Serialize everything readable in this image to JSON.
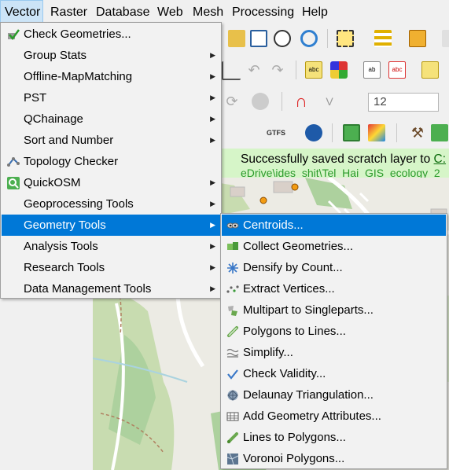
{
  "menubar": {
    "items": [
      {
        "label": "Vector",
        "active": true
      },
      {
        "label": "Raster"
      },
      {
        "label": "Database"
      },
      {
        "label": "Web"
      },
      {
        "label": "Mesh"
      },
      {
        "label": "Processing"
      },
      {
        "label": "Help"
      }
    ]
  },
  "toolbar": {
    "zoom_value": "12"
  },
  "message_bar": {
    "text": "Successfully saved scratch layer to ",
    "link": "C:",
    "path_fragment": "eDrive\\ides_shit\\Tel_Hai_GIS_ecology_2"
  },
  "vector_menu": {
    "items": [
      {
        "label": "Check Geometries...",
        "icon": "check-geometries-icon",
        "submenu": false
      },
      {
        "label": "Group Stats",
        "submenu": true
      },
      {
        "label": "Offline-MapMatching",
        "submenu": true
      },
      {
        "label": "PST",
        "submenu": true
      },
      {
        "label": "QChainage",
        "submenu": true
      },
      {
        "label": "Sort and Number",
        "submenu": true
      },
      {
        "label": "Topology Checker",
        "icon": "topology-checker-icon",
        "submenu": false
      },
      {
        "label": "QuickOSM",
        "icon": "quickosm-icon",
        "submenu": true
      },
      {
        "label": "Geoprocessing Tools",
        "submenu": true
      },
      {
        "label": "Geometry Tools",
        "submenu": true,
        "highlighted": true
      },
      {
        "label": "Analysis Tools",
        "submenu": true
      },
      {
        "label": "Research Tools",
        "submenu": true
      },
      {
        "label": "Data Management Tools",
        "submenu": true
      }
    ]
  },
  "geometry_tools_menu": {
    "items": [
      {
        "label": "Centroids...",
        "icon": "centroids-icon",
        "highlighted": true
      },
      {
        "label": "Collect Geometries...",
        "icon": "collect-geometries-icon"
      },
      {
        "label": "Densify by Count...",
        "icon": "densify-icon"
      },
      {
        "label": "Extract Vertices...",
        "icon": "extract-vertices-icon"
      },
      {
        "label": "Multipart to Singleparts...",
        "icon": "multipart-icon"
      },
      {
        "label": "Polygons to Lines...",
        "icon": "polygons-to-lines-icon"
      },
      {
        "label": "Simplify...",
        "icon": "simplify-icon"
      },
      {
        "label": "Check Validity...",
        "icon": "check-validity-icon"
      },
      {
        "label": "Delaunay Triangulation...",
        "icon": "delaunay-icon"
      },
      {
        "label": "Add Geometry Attributes...",
        "icon": "add-geometry-attributes-icon"
      },
      {
        "label": "Lines to Polygons...",
        "icon": "lines-to-polygons-icon"
      },
      {
        "label": "Voronoi Polygons...",
        "icon": "voronoi-icon"
      }
    ]
  },
  "colors": {
    "highlight": "#0078d7",
    "menu_bg": "#f2f2f2",
    "message_bg": "#d6f5c8",
    "map_green": "#c8dcb0",
    "map_forest": "#add19e"
  }
}
